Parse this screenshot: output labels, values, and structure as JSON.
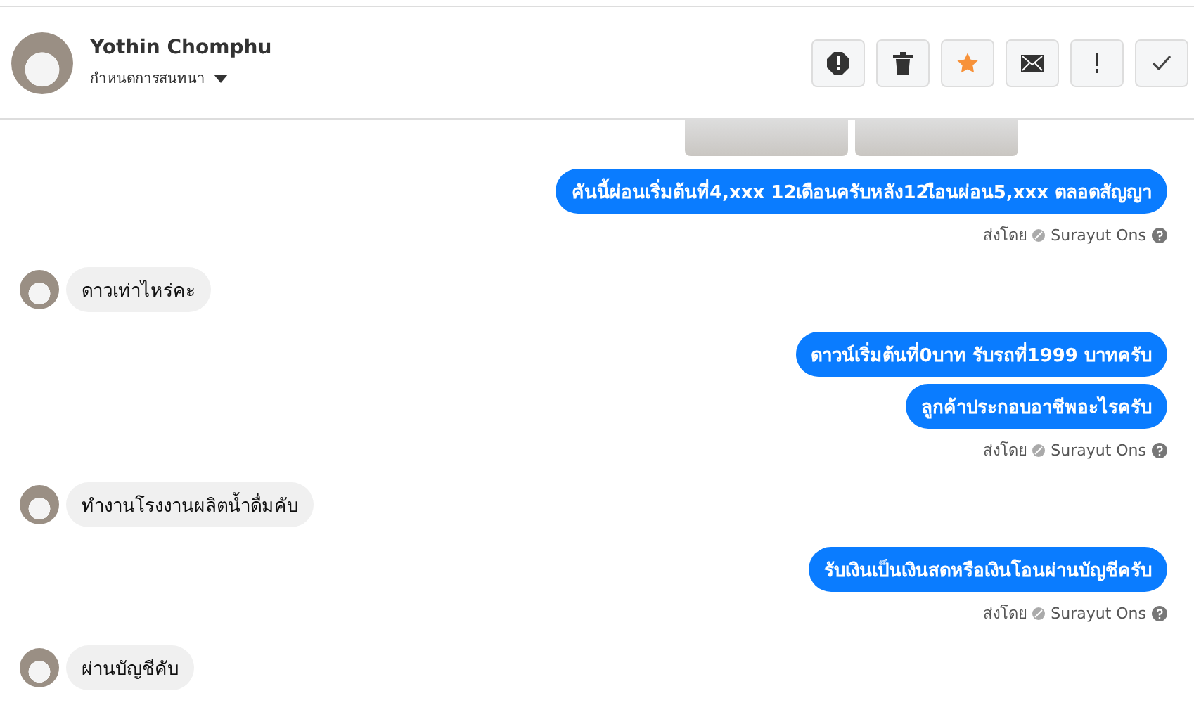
{
  "header": {
    "name": "Yothin Chomphu",
    "subtitle": "กำหนดการสนทนา",
    "actions": [
      {
        "kind": "spam"
      },
      {
        "kind": "delete"
      },
      {
        "kind": "star",
        "selected": true
      },
      {
        "kind": "mail"
      },
      {
        "kind": "important"
      },
      {
        "kind": "done"
      }
    ]
  },
  "groups": [
    {
      "kind": "outgoing",
      "attachments": [
        {
          "kind": "photo"
        },
        {
          "kind": "photo"
        }
      ],
      "messages": [
        "คันนี้ผ่อนเริ่มต้นที่4,xxx 12เดือนครับหลัง12เือนผ่อน5,xxx ตลอดสัญญา"
      ],
      "sent_by": {
        "label": "ส่งโดย",
        "name": "Surayut Ons"
      }
    },
    {
      "kind": "incoming",
      "messages": [
        "ดาวเท่าไหร่คะ"
      ]
    },
    {
      "kind": "outgoing",
      "messages": [
        "ดาวน์เริ่มต้นที่0บาท รับรถที่1999 บาทครับ",
        "ลูกค้าประกอบอาชีพอะไรครับ"
      ],
      "sent_by": {
        "label": "ส่งโดย",
        "name": "Surayut Ons"
      }
    },
    {
      "kind": "incoming",
      "messages": [
        "ทำงานโรงงานผลิตน้ำดื่มคับ"
      ]
    },
    {
      "kind": "outgoing",
      "messages": [
        "รับเงินเป็นเงินสดหรือเงินโอนผ่านบัญชีครับ"
      ],
      "sent_by": {
        "label": "ส่งโดย",
        "name": "Surayut Ons"
      }
    },
    {
      "kind": "incoming",
      "messages": [
        "ผ่านบัญชีคับ"
      ]
    }
  ]
}
